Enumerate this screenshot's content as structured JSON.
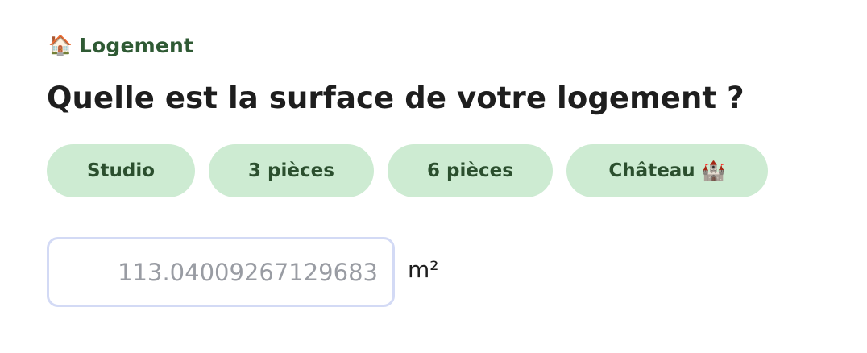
{
  "category": {
    "icon": "house-icon",
    "icon_glyph": "🏠",
    "label": "Logement"
  },
  "question": "Quelle est la surface de votre logement ?",
  "options": [
    {
      "label": "Studio"
    },
    {
      "label": "3 pièces"
    },
    {
      "label": "6 pièces"
    },
    {
      "label": "Château",
      "icon": "castle-icon",
      "icon_glyph": "🏰"
    }
  ],
  "surface_input": {
    "value": "",
    "placeholder": "113.04009267129683"
  },
  "unit": "m²",
  "colors": {
    "category_text": "#2f5a34",
    "chip_background": "#cdebd2",
    "chip_text": "#2b4f2e",
    "input_border": "#d3daf5",
    "placeholder_text": "#999ca3"
  }
}
